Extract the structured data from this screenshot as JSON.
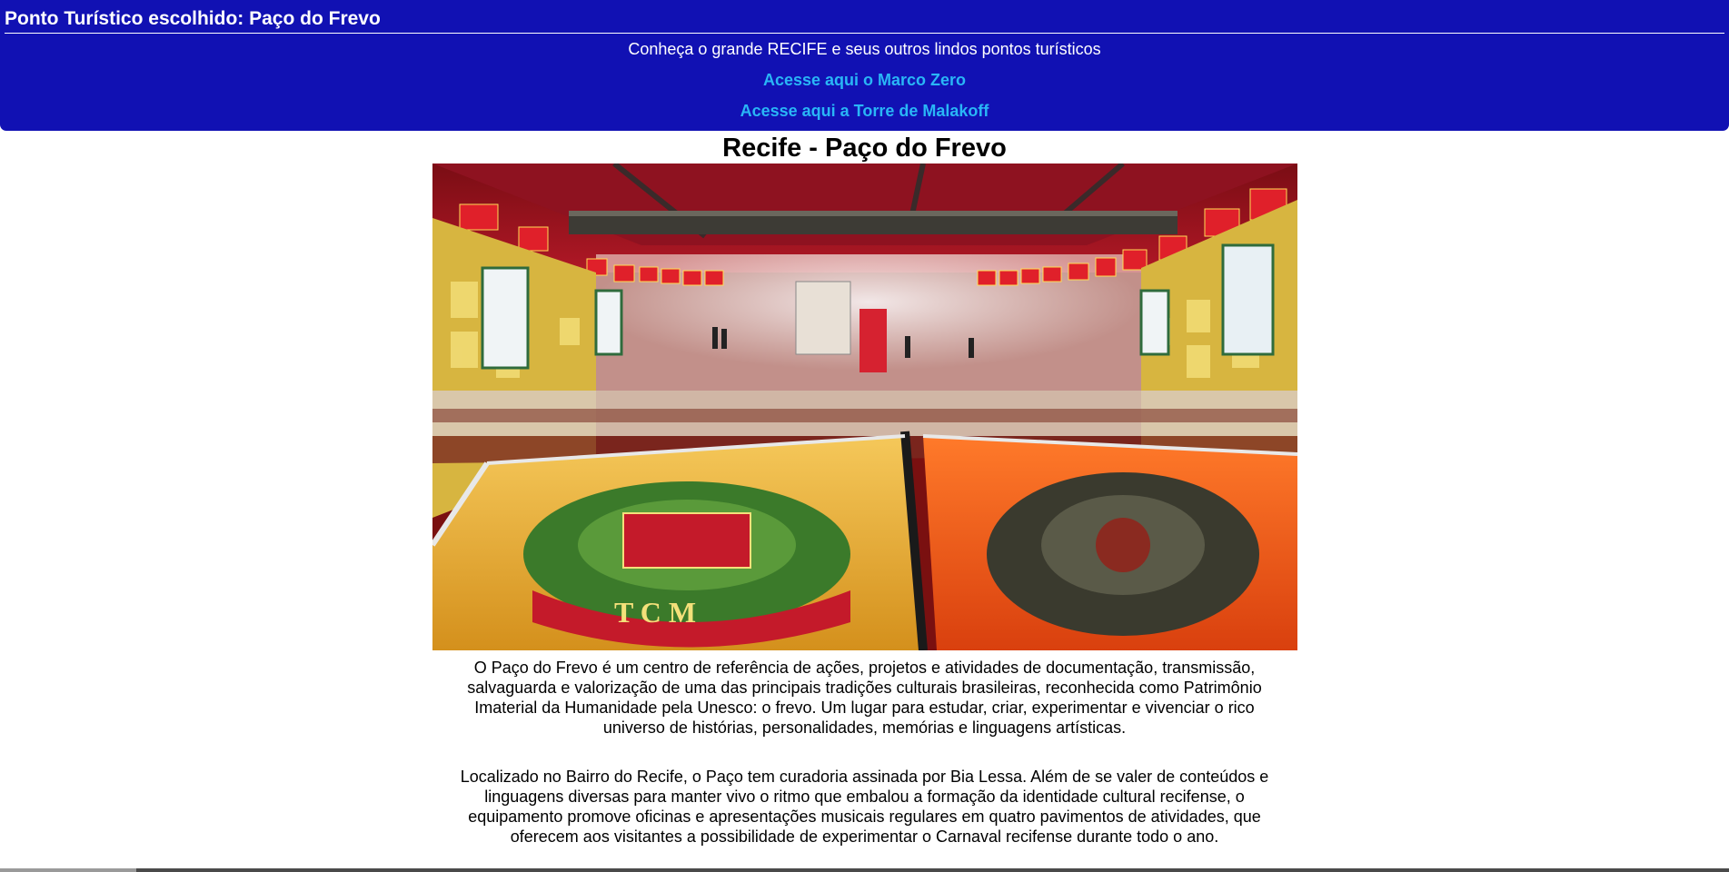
{
  "header": {
    "title": "Ponto Turístico escolhido: Paço do Frevo",
    "subtitle": "Conheça o grande RECIFE e seus outros lindos pontos turísticos",
    "links": [
      {
        "label": "Acesse aqui o Marco Zero"
      },
      {
        "label": "Acesse aqui a Torre de Malakoff"
      }
    ]
  },
  "main": {
    "title": "Recife - Paço do Frevo",
    "paragraphs": [
      "O Paço do Frevo é um centro de referência de ações, projetos e atividades de documentação, transmissão, salvaguarda e valorização de uma das principais tradições culturais brasileiras, reconhecida como Patrimônio Imaterial da Humanidade pela Unesco: o frevo. Um lugar para estudar, criar, experimentar e vivenciar o rico universo de histórias, personalidades, memórias e linguagens artísticas.",
      "Localizado no Bairro do Recife, o Paço tem curadoria assinada por Bia Lessa. Além de se valer de conteúdos e linguagens diversas para manter vivo o ritmo que embalou a formação da identidade cultural recifense, o equipamento promove oficinas e apresentações musicais regulares em quatro pavimentos de atividades, que oferecem aos visitantes a possibilidade de experimentar o Carnaval recifense durante todo o ano."
    ]
  },
  "colors": {
    "header_bg": "#1111b3",
    "link": "#29b6f6",
    "text": "#000000"
  }
}
